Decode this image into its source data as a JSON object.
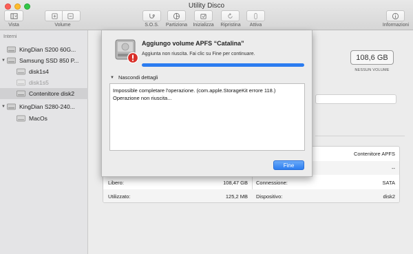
{
  "window": {
    "title": "Utility Disco"
  },
  "toolbar": {
    "vista_label": "Vista",
    "volume_label": "Volume",
    "sos_label": "S.O.S.",
    "partiziona_label": "Partiziona",
    "inizializza_label": "Inizializza",
    "ripristina_label": "Ripristina",
    "attiva_label": "Attiva",
    "informazioni_label": "Informazioni"
  },
  "sidebar": {
    "section": "Interni",
    "items": [
      {
        "label": "KingDian S200 60G..."
      },
      {
        "label": "Samsung SSD 850 P..."
      },
      {
        "label": "disk1s4"
      },
      {
        "label": "disk1s5"
      },
      {
        "label": "Contenitore disk2"
      },
      {
        "label": "KingDian S280-240..."
      },
      {
        "label": "MacOs"
      }
    ]
  },
  "volume_info": {
    "size": "108,6 GB",
    "size_caption": "NESSUN VOLUME"
  },
  "info_table": {
    "row1": {
      "right_value": "Contenitore APFS"
    },
    "row2": {
      "right_value": "--"
    },
    "row3": {
      "left_label": "Libero:",
      "left_value": "108,47 GB",
      "right_label": "Connessione:",
      "right_value": "SATA"
    },
    "row4": {
      "left_label": "Utilizzato:",
      "left_value": "125,2 MB",
      "right_label": "Dispositivo:",
      "right_value": "disk2"
    }
  },
  "dialog": {
    "title": "Aggiungo volume APFS “Catalina”",
    "subtitle": "Aggiunta non riuscita. Fai clic su Fine per continuare.",
    "progress": 1.0,
    "details_toggle": "Nascondi dettagli",
    "log_line1": "Impossible completare l'operazione. (com.apple.StorageKit errore 118.)",
    "log_line2": "Operazione non riuscita...",
    "done_label": "Fine"
  },
  "colors": {
    "accent": "#2b7cf0",
    "error_badge": "#d9302a"
  }
}
